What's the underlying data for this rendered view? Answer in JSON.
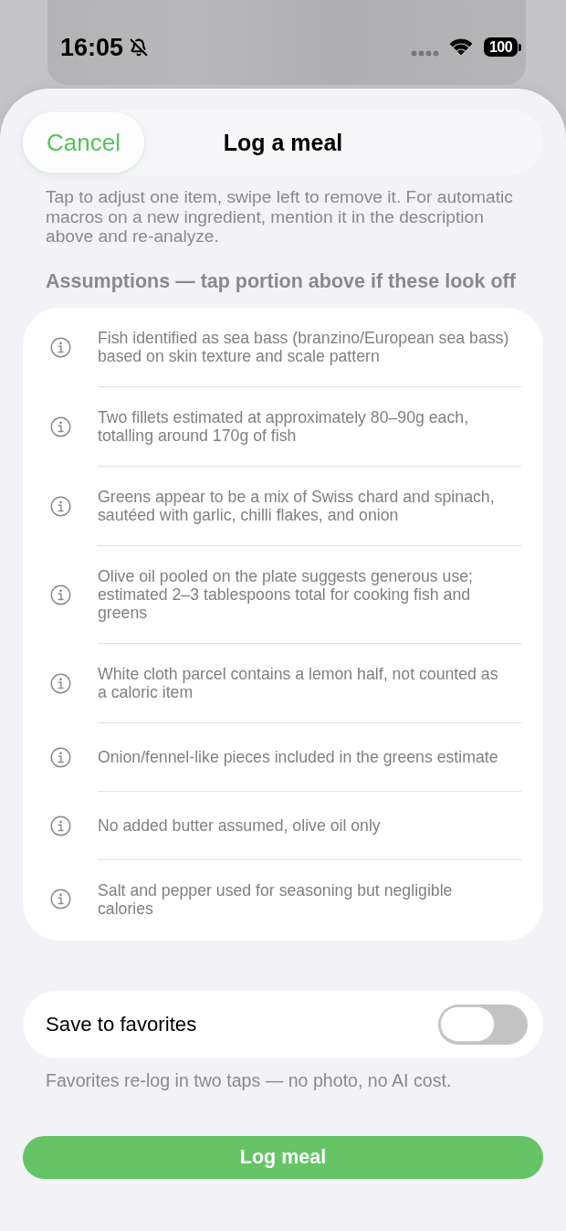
{
  "status_bar": {
    "time": "16:05",
    "silent": true,
    "battery": "100"
  },
  "header": {
    "cancel": "Cancel",
    "title": "Log a meal"
  },
  "instructions": "Tap to adjust one item, swipe left to remove it. For automatic macros on a new ingredient, mention it in the description above and re-analyze.",
  "assumptions": {
    "heading": "Assumptions — tap portion above if these look off",
    "items": [
      {
        "text": "Fish identified as sea bass (branzino/European sea bass) based on skin texture and scale pattern"
      },
      {
        "text": "Two fillets estimated at approximately 80–90g each, totalling around 170g of fish"
      },
      {
        "text": "Greens appear to be a mix of Swiss chard and spinach, sautéed with garlic, chilli flakes, and onion"
      },
      {
        "text": "Olive oil pooled on the plate suggests generous use; estimated 2–3 tablespoons total for cooking fish and greens"
      },
      {
        "text": "White cloth parcel contains a lemon half, not counted as a caloric item"
      },
      {
        "text": "Onion/fennel-like pieces included in the greens estimate"
      },
      {
        "text": "No added butter assumed, olive oil only"
      },
      {
        "text": "Salt and pepper used for seasoning but negligible calories"
      }
    ]
  },
  "favorites": {
    "label": "Save to favorites",
    "on": false,
    "note": "Favorites re-log in two taps — no photo, no AI cost."
  },
  "submit": "Log meal"
}
